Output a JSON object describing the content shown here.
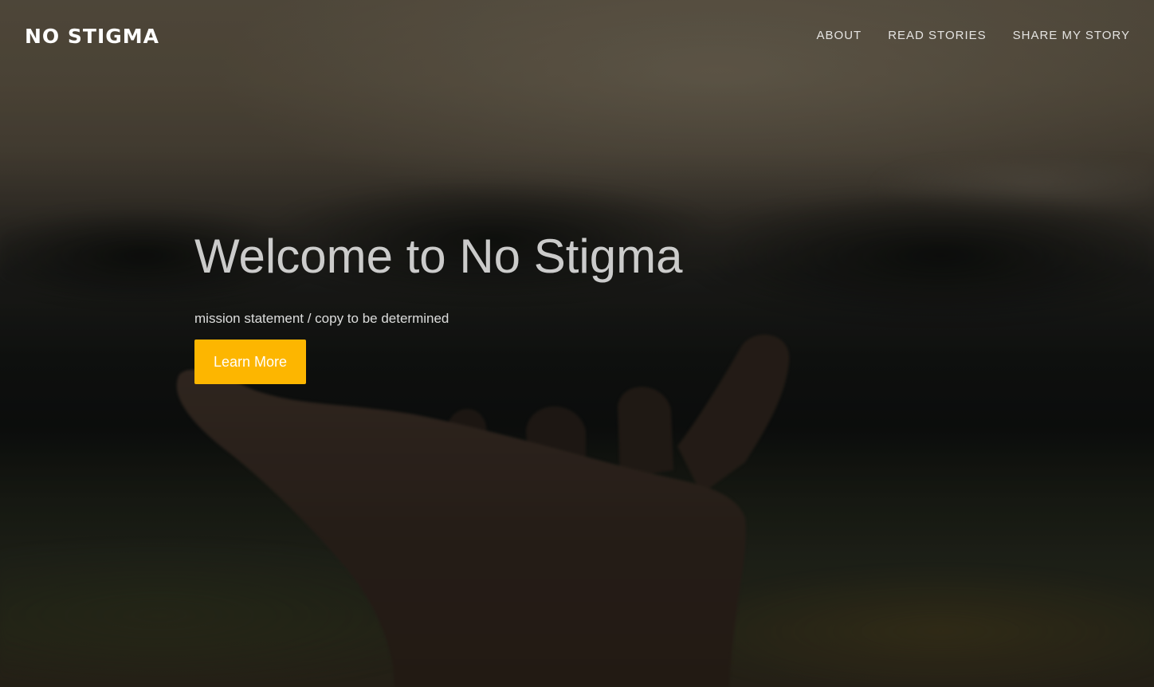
{
  "brand": {
    "name": "NO STIGMA"
  },
  "nav": {
    "items": [
      {
        "label": "ABOUT"
      },
      {
        "label": "READ STORIES"
      },
      {
        "label": "SHARE MY STORY"
      }
    ]
  },
  "hero": {
    "title": "Welcome to No Stigma",
    "subtitle": "mission statement / copy to be determined",
    "cta_label": "Learn More",
    "cta_color": "#FDB600"
  }
}
